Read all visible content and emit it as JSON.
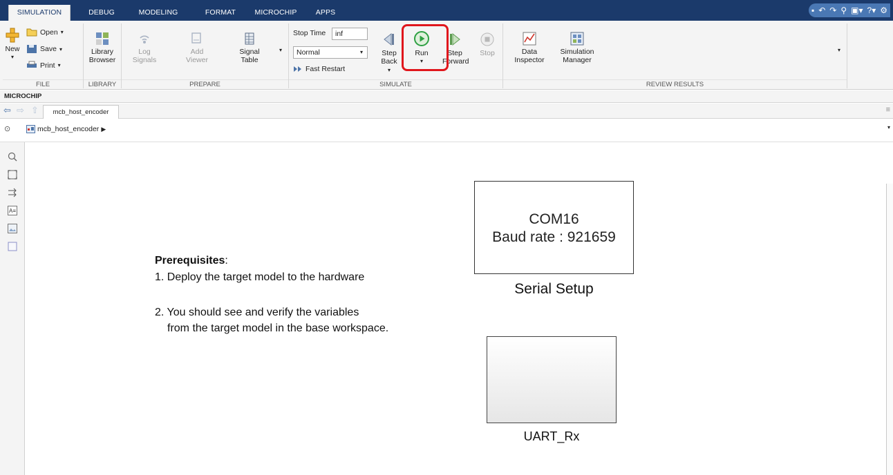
{
  "tabs": {
    "simulation": "SIMULATION",
    "debug": "DEBUG",
    "modeling": "MODELING",
    "format": "FORMAT",
    "microchip": "MICROCHIP",
    "apps": "APPS"
  },
  "ribbon": {
    "file": {
      "new": "New",
      "open": "Open",
      "save": "Save",
      "print": "Print",
      "label": "FILE"
    },
    "library": {
      "line1": "Library",
      "line2": "Browser",
      "label": "LIBRARY"
    },
    "prepare": {
      "log_line1": "Log",
      "log_line2": "Signals",
      "add_line1": "Add",
      "add_line2": "Viewer",
      "signal_line1": "Signal",
      "signal_line2": "Table",
      "label": "PREPARE"
    },
    "simulate": {
      "stop_time_label": "Stop Time",
      "stop_time_value": "inf",
      "mode_value": "Normal",
      "fast_restart": "Fast Restart",
      "step_back_line1": "Step",
      "step_back_line2": "Back",
      "run": "Run",
      "step_forward_line1": "Step",
      "step_forward_line2": "Forward",
      "stop": "Stop",
      "label": "SIMULATE"
    },
    "review": {
      "data_line1": "Data",
      "data_line2": "Inspector",
      "sim_line1": "Simulation",
      "sim_line2": "Manager",
      "label": "REVIEW RESULTS"
    }
  },
  "section_title": "MICROCHIP",
  "nav_tab": "mcb_host_encoder",
  "breadcrumb": "mcb_host_encoder",
  "canvas": {
    "prereq_title": "Prerequisites",
    "prereq_colon": ":",
    "step1": "1. Deploy the target model to the hardware",
    "step2_line1": "2. You should see and verify the variables",
    "step2_line2": "from the target model in the base workspace.",
    "serial_block_line1": "COM16",
    "serial_block_line2": "Baud rate : 921659",
    "serial_label": "Serial Setup",
    "uart_label": "UART_Rx"
  },
  "colors": {
    "tabbar": "#1b3a6b",
    "run_green": "#2ea043",
    "highlight": "#e0161c"
  }
}
